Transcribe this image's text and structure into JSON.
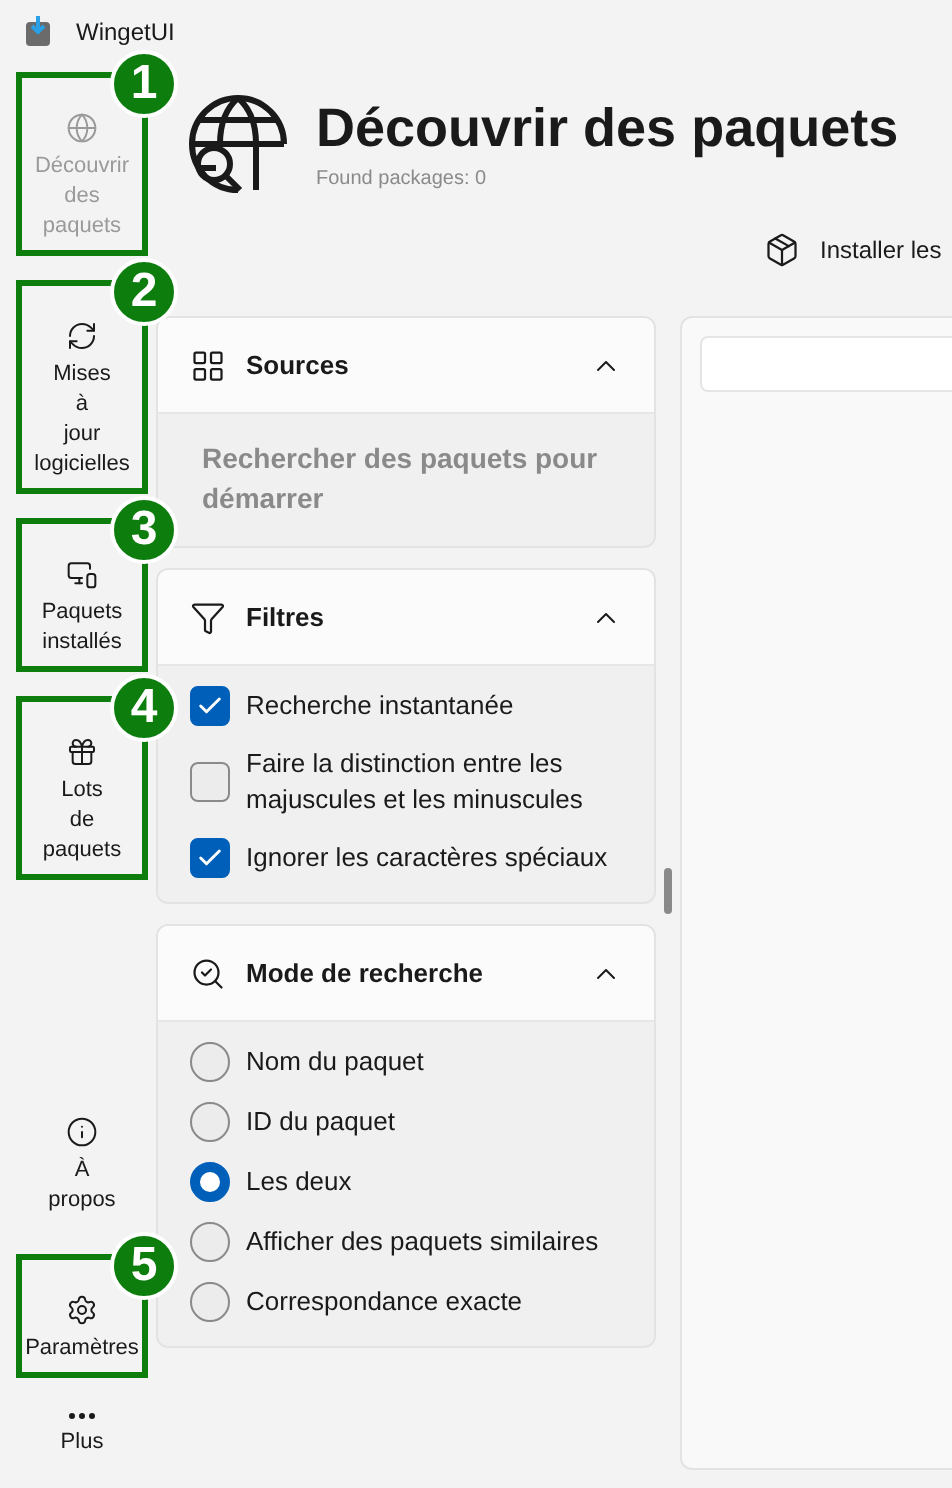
{
  "app": {
    "title": "WingetUI"
  },
  "nav": [
    {
      "label": "Découvrir\ndes\npaquets",
      "selected": true,
      "callout": "1"
    },
    {
      "label": "Mises\nà\njour\nlogicielles",
      "selected": false,
      "callout": "2"
    },
    {
      "label": "Paquets\ninstallés",
      "selected": false,
      "callout": "3"
    },
    {
      "label": "Lots\nde\npaquets",
      "selected": false,
      "callout": "4"
    }
  ],
  "nav_bottom": [
    {
      "label": "À\npropos",
      "selected": false
    },
    {
      "label": "Paramètres",
      "selected": false,
      "callout": "5"
    },
    {
      "label": "Plus",
      "selected": false
    }
  ],
  "header": {
    "title": "Découvrir des paquets",
    "subtitle": "Found packages: 0"
  },
  "toolbar": {
    "button": "Installer les"
  },
  "sources": {
    "title": "Sources",
    "expanded": true,
    "message": "Rechercher des paquets pour démarrer"
  },
  "filters": {
    "title": "Filtres",
    "expanded": true,
    "options": [
      {
        "label": "Recherche instantanée",
        "checked": true
      },
      {
        "label": "Faire la distinction entre les majuscules et les minuscules",
        "checked": false
      },
      {
        "label": "Ignorer les caractères spéciaux",
        "checked": true
      }
    ]
  },
  "search_mode": {
    "title": "Mode de recherche",
    "expanded": true,
    "options": [
      {
        "label": "Nom du paquet",
        "selected": false
      },
      {
        "label": "ID du paquet",
        "selected": false
      },
      {
        "label": "Les deux",
        "selected": true
      },
      {
        "label": "Afficher des paquets similaires",
        "selected": false
      },
      {
        "label": "Correspondance exacte",
        "selected": false
      }
    ]
  }
}
